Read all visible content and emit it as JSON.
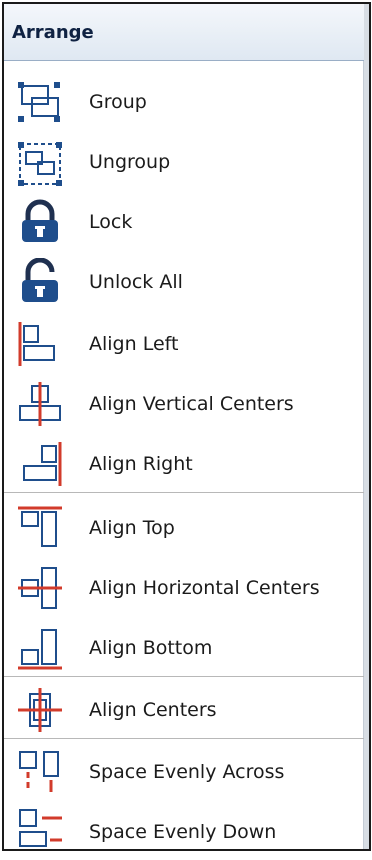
{
  "panel": {
    "title": "Arrange"
  },
  "items": [
    {
      "label": "Group",
      "icon": "group-icon"
    },
    {
      "label": "Ungroup",
      "icon": "ungroup-icon"
    },
    {
      "label": "Lock",
      "icon": "lock-icon"
    },
    {
      "label": "Unlock All",
      "icon": "unlock-icon"
    },
    {
      "label": "Align Left",
      "icon": "align-left-icon"
    },
    {
      "label": "Align Vertical Centers",
      "icon": "align-vertical-centers-icon"
    },
    {
      "label": "Align Right",
      "icon": "align-right-icon"
    },
    {
      "label": "Align Top",
      "icon": "align-top-icon"
    },
    {
      "label": "Align Horizontal Centers",
      "icon": "align-horizontal-centers-icon"
    },
    {
      "label": "Align Bottom",
      "icon": "align-bottom-icon"
    },
    {
      "label": "Align Centers",
      "icon": "align-centers-icon"
    },
    {
      "label": "Space Evenly Across",
      "icon": "space-evenly-across-icon"
    },
    {
      "label": "Space Evenly Down",
      "icon": "space-evenly-down-icon"
    }
  ],
  "colors": {
    "icon_blue": "#1f4e8c",
    "guide_red": "#d23b2b",
    "header_text": "#0f2242"
  }
}
